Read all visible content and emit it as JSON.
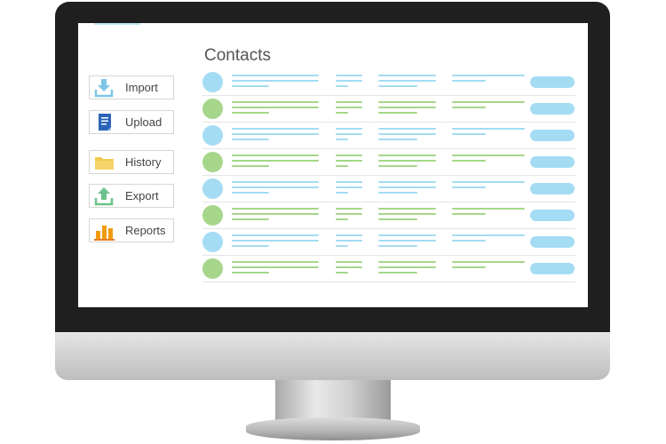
{
  "sidebar": {
    "buttons": [
      {
        "label": "Import",
        "icon": "download-tray-icon"
      },
      {
        "label": "Upload",
        "icon": "document-icon"
      },
      {
        "label": "History",
        "icon": "folder-icon"
      },
      {
        "label": "Export",
        "icon": "upload-tray-icon"
      },
      {
        "label": "Reports",
        "icon": "bar-chart-icon"
      }
    ]
  },
  "main": {
    "title": "Contacts",
    "rows": [
      {
        "kind": "blue"
      },
      {
        "kind": "green"
      },
      {
        "kind": "blue"
      },
      {
        "kind": "green"
      },
      {
        "kind": "blue"
      },
      {
        "kind": "green"
      },
      {
        "kind": "blue"
      },
      {
        "kind": "green"
      }
    ]
  },
  "colors": {
    "blue": "#a4dcf3",
    "green": "#a6d68a",
    "pill": "#a4dcf3",
    "frame": "#1f1f1f"
  }
}
